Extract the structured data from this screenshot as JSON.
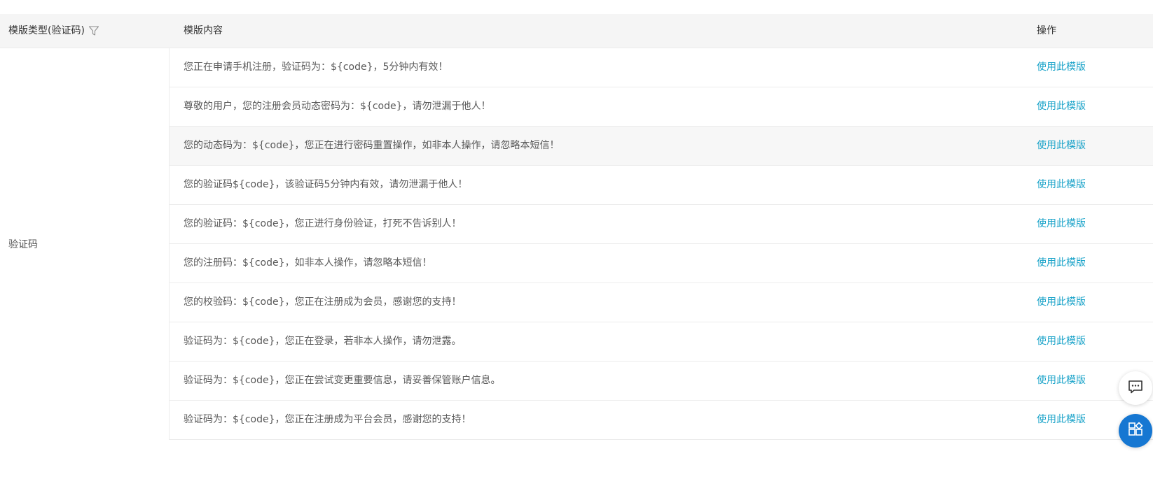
{
  "table": {
    "headers": {
      "type": "模版类型(验证码)",
      "content": "模版内容",
      "operation": "操作"
    },
    "type_value": "验证码",
    "rows": [
      {
        "content": "您正在申请手机注册，验证码为：${code}，5分钟内有效！",
        "action": "使用此模版"
      },
      {
        "content": "尊敬的用户，您的注册会员动态密码为：${code}，请勿泄漏于他人！",
        "action": "使用此模版"
      },
      {
        "content": "您的动态码为：${code}，您正在进行密码重置操作，如非本人操作，请忽略本短信！",
        "action": "使用此模版"
      },
      {
        "content": "您的验证码${code}，该验证码5分钟内有效，请勿泄漏于他人！",
        "action": "使用此模版"
      },
      {
        "content": "您的验证码：${code}，您正进行身份验证，打死不告诉别人！",
        "action": "使用此模版"
      },
      {
        "content": "您的注册码：${code}，如非本人操作，请忽略本短信！",
        "action": "使用此模版"
      },
      {
        "content": "您的校验码：${code}，您正在注册成为会员，感谢您的支持！",
        "action": "使用此模版"
      },
      {
        "content": "验证码为：${code}，您正在登录，若非本人操作，请勿泄露。",
        "action": "使用此模版"
      },
      {
        "content": "验证码为：${code}，您正在尝试变更重要信息，请妥善保管账户信息。",
        "action": "使用此模版"
      },
      {
        "content": "验证码为：${code}，您正在注册成为平台会员，感谢您的支持！",
        "action": "使用此模版"
      }
    ]
  },
  "icons": {
    "filter": "filter-icon",
    "chat": "chat-icon",
    "apps": "apps-icon"
  },
  "colors": {
    "link": "#1aa3c9",
    "header_bg": "#f5f5f5",
    "hover_row_bg": "#f7f7f7",
    "float_primary": "#1677d2"
  }
}
